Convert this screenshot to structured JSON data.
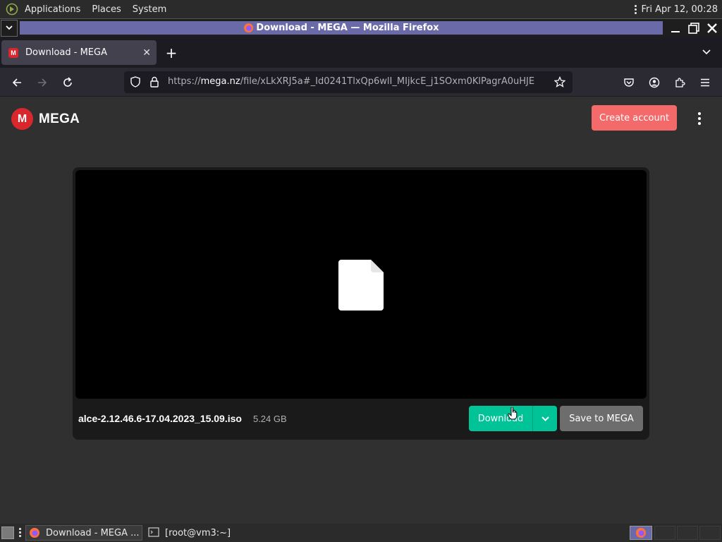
{
  "top_panel": {
    "menus": [
      "Applications",
      "Places",
      "System"
    ],
    "clock": "Fri Apr 12, 00:28"
  },
  "window": {
    "title": "Download - MEGA — Mozilla Firefox"
  },
  "browser": {
    "tab_title": "Download - MEGA",
    "url_prefix": "https://",
    "url_host": "mega.nz",
    "url_path": "/file/xLkXRJ5a#_Id0241TlxQp6wlI_MIjkcE_j1SOxm0KlPagrA0uHJE"
  },
  "page": {
    "logo_text": "MEGA",
    "logo_letter": "M",
    "create_account": "Create account",
    "file_name": "alce-2.12.46.6-17.04.2023_15.09.iso",
    "file_size": "5.24 GB",
    "download_label": "Download",
    "save_label": "Save to MEGA",
    "accent": "#00c398",
    "brand_red": "#d9272e"
  },
  "taskbar": {
    "active_task": "Download - MEGA ...",
    "terminal_task": "[root@vm3:~]"
  }
}
